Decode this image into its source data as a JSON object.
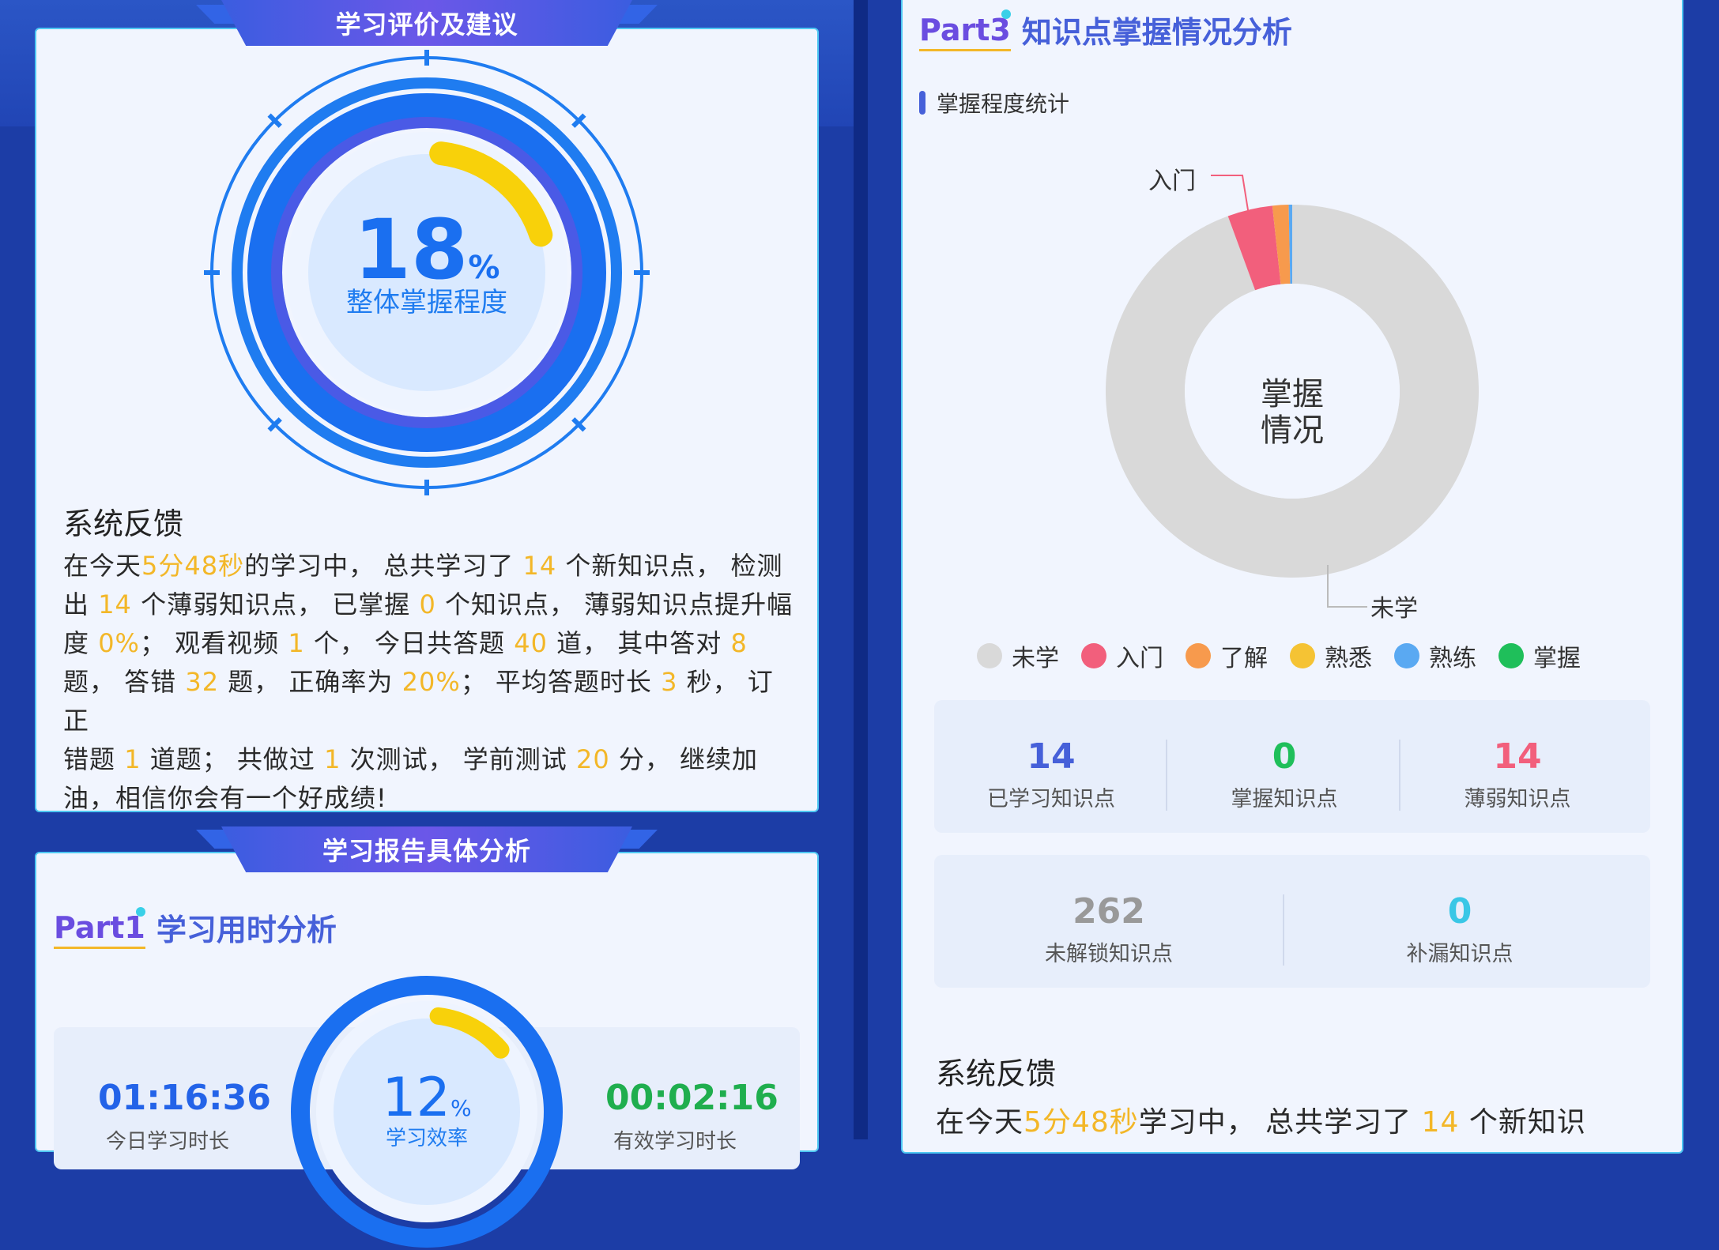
{
  "left": {
    "section1_title": "学习评价及建议",
    "gauge": {
      "percent_value": "18",
      "percent_sign": "%",
      "label": "整体掌握程度",
      "progress": 0.18
    },
    "feedback_title": "系统反馈",
    "feedback_lines": [
      [
        {
          "t": "在今天"
        },
        {
          "t": "5分48秒",
          "h": true
        },
        {
          "t": "的学习中， 总共学习了 "
        },
        {
          "t": "14",
          "h": true
        },
        {
          "t": " 个新知识点， 检测"
        }
      ],
      [
        {
          "t": "出 "
        },
        {
          "t": "14",
          "h": true
        },
        {
          "t": " 个薄弱知识点， 已掌握 "
        },
        {
          "t": "0",
          "h": true
        },
        {
          "t": " 个知识点， 薄弱知识点提升幅"
        }
      ],
      [
        {
          "t": "度 "
        },
        {
          "t": "0%",
          "h": true
        },
        {
          "t": "； 观看视频 "
        },
        {
          "t": "1",
          "h": true
        },
        {
          "t": " 个， 今日共答题 "
        },
        {
          "t": "40",
          "h": true
        },
        {
          "t": " 道， 其中答对 "
        },
        {
          "t": "8",
          "h": true
        }
      ],
      [
        {
          "t": "题， 答错 "
        },
        {
          "t": "32",
          "h": true
        },
        {
          "t": " 题， 正确率为 "
        },
        {
          "t": "20%",
          "h": true
        },
        {
          "t": "； 平均答题时长 "
        },
        {
          "t": "3",
          "h": true
        },
        {
          "t": " 秒， 订正"
        }
      ],
      [
        {
          "t": "错题 "
        },
        {
          "t": "1",
          "h": true
        },
        {
          "t": " 道题； 共做过 "
        },
        {
          "t": "1",
          "h": true
        },
        {
          "t": " 次测试， 学前测试 "
        },
        {
          "t": "20",
          "h": true
        },
        {
          "t": " 分， 继续加"
        }
      ],
      [
        {
          "t": "油，相信你会有一个好成绩!"
        }
      ]
    ],
    "section2_title": "学习报告具体分析",
    "part1": {
      "tag": "Part",
      "num": "1",
      "name": "学习用时分析"
    },
    "time_today": {
      "value": "01:16:36",
      "label": "今日学习时长"
    },
    "efficiency": {
      "value": "12",
      "sign": "%",
      "label": "学习效率",
      "progress": 0.12
    },
    "time_effective": {
      "value": "00:02:16",
      "label": "有效学习时长"
    }
  },
  "right": {
    "part3": {
      "tag": "Part",
      "num": "3",
      "name": "知识点掌握情况分析"
    },
    "subhead": "掌握程度统计",
    "chart_data": {
      "type": "pie",
      "center_label_line1": "掌握",
      "center_label_line2": "情况",
      "annotations": [
        "入门",
        "未学"
      ],
      "categories": [
        "未学",
        "入门",
        "了解",
        "熟悉",
        "熟练",
        "掌握"
      ],
      "values": [
        94.4,
        3.9,
        1.4,
        0,
        0.3,
        0
      ],
      "colors": [
        "#d9d9d9",
        "#f25f7c",
        "#f79a4d",
        "#f5c334",
        "#5aa9f2",
        "#1fbf5a"
      ]
    },
    "stats_row1": [
      {
        "value": "14",
        "label": "已学习知识点",
        "color": "#4660d9"
      },
      {
        "value": "0",
        "label": "掌握知识点",
        "color": "#1fbf5a"
      },
      {
        "value": "14",
        "label": "薄弱知识点",
        "color": "#f25f7c"
      }
    ],
    "stats_row2": [
      {
        "value": "262",
        "label": "未解锁知识点",
        "color": "#999999"
      },
      {
        "value": "0",
        "label": "补漏知识点",
        "color": "#39c7e6"
      }
    ],
    "feedback_title": "系统反馈",
    "feedback_line": [
      {
        "t": "在今天"
      },
      {
        "t": "5分48秒",
        "h": true
      },
      {
        "t": "学习中， 总共学习了 "
      },
      {
        "t": "14",
        "h": true
      },
      {
        "t": " 个新知识"
      }
    ]
  }
}
